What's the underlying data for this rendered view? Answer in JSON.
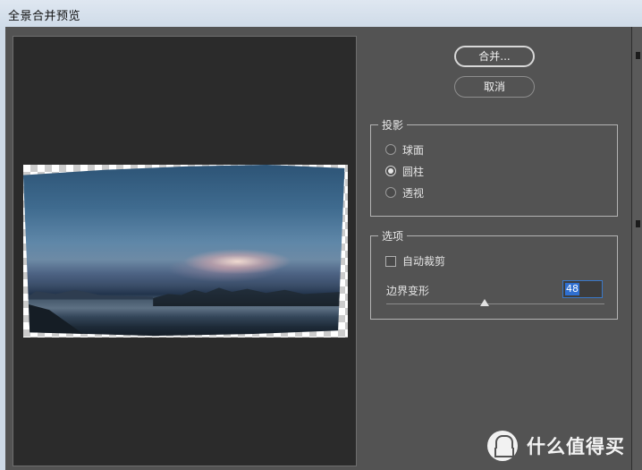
{
  "window": {
    "title": "全景合并预览"
  },
  "buttons": {
    "merge": "合并...",
    "cancel": "取消"
  },
  "projection": {
    "legend": "投影",
    "options": [
      {
        "label": "球面",
        "selected": false
      },
      {
        "label": "圆柱",
        "selected": true
      },
      {
        "label": "透视",
        "selected": false
      }
    ]
  },
  "options": {
    "legend": "选项",
    "auto_crop": {
      "label": "自动裁剪",
      "checked": false
    },
    "boundary_warp": {
      "label": "边界变形",
      "value": "48",
      "slider_fraction": 0.45
    }
  },
  "watermark": {
    "text": "什么值得买",
    "logo_text": "值"
  }
}
